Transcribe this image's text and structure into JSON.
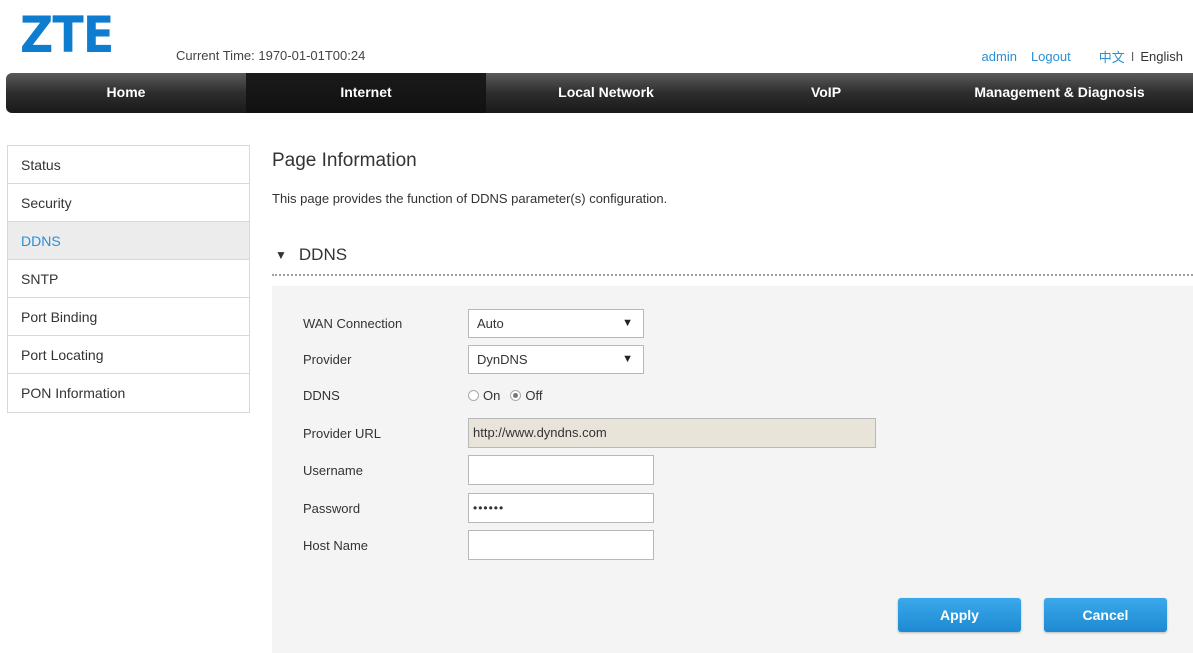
{
  "header": {
    "logo": "ZTE",
    "current_time": "Current Time: 1970-01-01T00:24",
    "user": "admin",
    "logout": "Logout",
    "lang_cn": "中文",
    "lang_sep": "I",
    "lang_en": "English"
  },
  "nav": {
    "items": [
      "Home",
      "Internet",
      "Local Network",
      "VoIP",
      "Management & Diagnosis"
    ],
    "active": "Internet"
  },
  "sidebar": {
    "items": [
      "Status",
      "Security",
      "DDNS",
      "SNTP",
      "Port Binding",
      "Port Locating",
      "PON Information"
    ],
    "active": "DDNS"
  },
  "page": {
    "title": "Page Information",
    "description": "This page provides the function of DDNS parameter(s) configuration."
  },
  "section": {
    "title": "DDNS",
    "expanded_icon": "triangle-down-icon"
  },
  "form": {
    "wan_connection": {
      "label": "WAN Connection",
      "value": "Auto"
    },
    "provider": {
      "label": "Provider",
      "value": "DynDNS"
    },
    "ddns": {
      "label": "DDNS",
      "on_label": "On",
      "off_label": "Off",
      "selected": "Off"
    },
    "provider_url": {
      "label": "Provider URL",
      "value": "http://www.dyndns.com"
    },
    "username": {
      "label": "Username",
      "value": ""
    },
    "password": {
      "label": "Password",
      "value": "••••••"
    },
    "host_name": {
      "label": "Host Name",
      "value": ""
    }
  },
  "buttons": {
    "apply": "Apply",
    "cancel": "Cancel"
  },
  "colors": {
    "brand": "#0e7ccf",
    "link": "#2a8fd6",
    "button": "#1d8ad2",
    "nav_bg": "#2d2d2d"
  }
}
